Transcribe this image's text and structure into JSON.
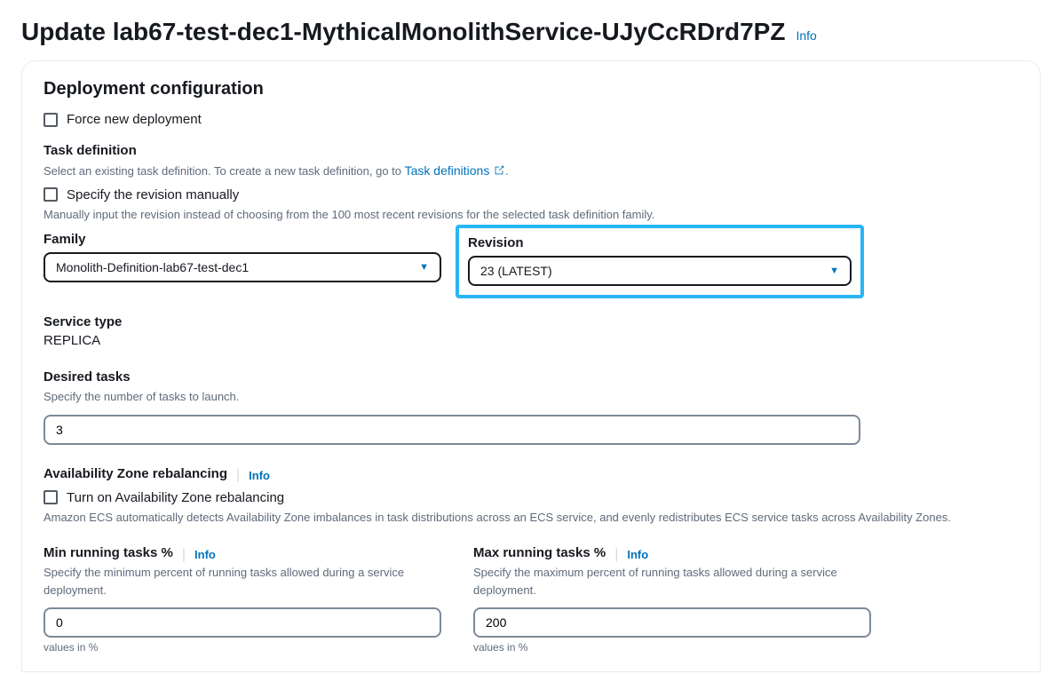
{
  "header": {
    "title_prefix": "Update",
    "title_name": "lab67-test-dec1-MythicalMonolithService-UJyCcRDrd7PZ",
    "info": "Info"
  },
  "section": {
    "title": "Deployment configuration",
    "force_new": "Force new deployment",
    "task_def": {
      "label": "Task definition",
      "helper_pre": "Select an existing task definition. To create a new task definition, go to ",
      "link": "Task definitions",
      "helper_post": ".",
      "specify_manually": "Specify the revision manually",
      "specify_helper": "Manually input the revision instead of choosing from the 100 most recent revisions for the selected task definition family."
    },
    "family": {
      "label": "Family",
      "value": "Monolith-Definition-lab67-test-dec1"
    },
    "revision": {
      "label": "Revision",
      "value": "23 (LATEST)"
    },
    "service_type": {
      "label": "Service type",
      "value": "REPLICA"
    },
    "desired_tasks": {
      "label": "Desired tasks",
      "helper": "Specify the number of tasks to launch.",
      "value": "3"
    },
    "az_rebalancing": {
      "label": "Availability Zone rebalancing",
      "info": "Info",
      "checkbox_label": "Turn on Availability Zone rebalancing",
      "helper": "Amazon ECS automatically detects Availability Zone imbalances in task distributions across an ECS service, and evenly redistributes ECS service tasks across Availability Zones."
    },
    "min_running": {
      "label": "Min running tasks %",
      "info": "Info",
      "helper": "Specify the minimum percent of running tasks allowed during a service deployment.",
      "value": "0",
      "note": "values in %"
    },
    "max_running": {
      "label": "Max running tasks %",
      "info": "Info",
      "helper": "Specify the maximum percent of running tasks allowed during a service deployment.",
      "value": "200",
      "note": "values in %"
    }
  }
}
